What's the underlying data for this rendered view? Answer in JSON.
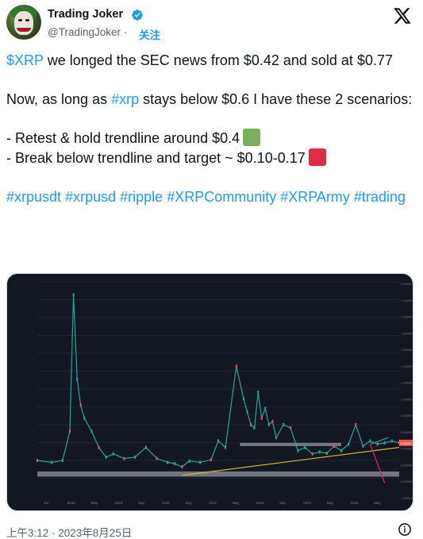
{
  "author": {
    "name": "Trading Joker",
    "handle": "@TradingJoker",
    "separator": "·",
    "follow_label": "关注"
  },
  "tweet": {
    "line1_ticker": "$XRP",
    "line1_rest": " we longed the SEC news from $0.42 and sold at $0.77",
    "line2_pre": "Now, as long as ",
    "line2_tag": "#xrp",
    "line2_post": " stays below $0.6 I have these 2 scenarios:",
    "scenario1": "- Retest & hold trendline around $0.4",
    "scenario2": "- Break below trendline and target ~ $0.10-0.17",
    "hashtags": [
      "#xrpusdt",
      "#xrpusd",
      "#ripple",
      "#XRPCommunity",
      "#XRPArmy",
      "#trading"
    ]
  },
  "timestamp": "上午3:12 · 2023年8月25日",
  "colors": {
    "link": "#1d9bf0",
    "green_square": "#78b159",
    "red_square": "#dd2e44",
    "chart_bg": "#131722"
  },
  "icons": {
    "verified": "verified-badge-icon",
    "x_logo": "x-logo-icon",
    "info": "info-icon"
  },
  "chart_data": {
    "type": "line",
    "x_axis_labels": [
      "Jul",
      "2018",
      "May",
      "2019",
      "May",
      "2020",
      "May",
      "2021",
      "May",
      "2022",
      "May",
      "2023",
      "May",
      "2024",
      "May"
    ],
    "y_axis_labels": [
      "3.00000",
      "2.50000",
      "2.00000",
      "1.80000",
      "1.60000",
      "1.40000",
      "1.20000",
      "1.00000",
      "0.80000",
      "0.60000",
      "0.40000",
      "0.20000",
      "0.00000",
      "-0.20000"
    ],
    "price_label": "0.52000",
    "series": [
      {
        "x": [
          0,
          4,
          7,
          9,
          10,
          11,
          12,
          13,
          15,
          17,
          19,
          21,
          24,
          27,
          30,
          33,
          36,
          38,
          40,
          42,
          45,
          48,
          50,
          52,
          55,
          57,
          58,
          59,
          60,
          61,
          62,
          63,
          64,
          65,
          66,
          68,
          70,
          72,
          74,
          76,
          78,
          80,
          82,
          84,
          86,
          88,
          90,
          92,
          94,
          96,
          98,
          100
        ],
        "values": [
          0.25,
          0.22,
          0.25,
          0.7,
          2.8,
          1.5,
          1.1,
          0.9,
          0.7,
          0.45,
          0.3,
          0.35,
          0.28,
          0.3,
          0.45,
          0.28,
          0.22,
          0.2,
          0.15,
          0.24,
          0.22,
          0.26,
          0.55,
          0.45,
          1.7,
          1.2,
          1.0,
          0.8,
          0.75,
          1.3,
          0.9,
          1.05,
          0.8,
          0.85,
          0.6,
          0.8,
          0.75,
          0.4,
          0.45,
          0.35,
          0.38,
          0.36,
          0.47,
          0.4,
          0.5,
          0.8,
          0.47,
          0.55,
          0.5,
          0.52,
          0.55,
          0.52
        ]
      }
    ],
    "resistance_zone": [
      0.47,
      0.52
    ],
    "support_zone": [
      0.0,
      0.08
    ],
    "trendline": [
      [
        40,
        0.02
      ],
      [
        100,
        0.45
      ]
    ],
    "scenario_green_target": 0.6,
    "scenario_red_target": 0.12,
    "ylim": [
      -0.3,
      3.0
    ]
  }
}
